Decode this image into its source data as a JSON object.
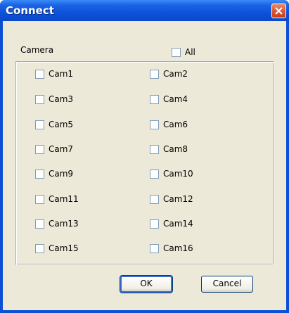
{
  "window": {
    "title": "Connect"
  },
  "camera_label": "Camera",
  "all_label": "All",
  "cameras": [
    "Cam1",
    "Cam2",
    "Cam3",
    "Cam4",
    "Cam5",
    "Cam6",
    "Cam7",
    "Cam8",
    "Cam9",
    "Cam10",
    "Cam11",
    "Cam12",
    "Cam13",
    "Cam14",
    "Cam15",
    "Cam16"
  ],
  "buttons": {
    "ok": "OK",
    "cancel": "Cancel"
  }
}
